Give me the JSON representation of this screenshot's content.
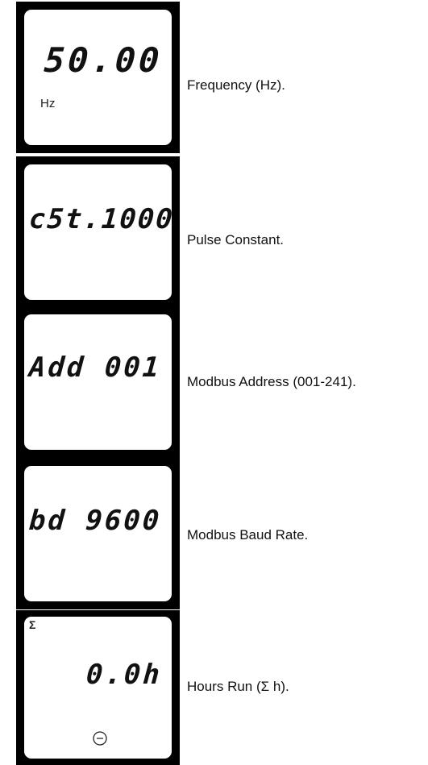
{
  "rows": [
    {
      "display": "50.00",
      "unit": "Hz",
      "caption": "Frequency (Hz)."
    },
    {
      "display": "c5t.1000",
      "caption": "Pulse Constant."
    },
    {
      "display": "Add 001",
      "caption": "Modbus Address (001-241)."
    },
    {
      "display": "bd 9600",
      "caption": "Modbus Baud Rate."
    },
    {
      "display": "0.0h",
      "indicator": "Σ",
      "caption": "Hours Run (Σ h).",
      "icon": "clock-icon"
    }
  ]
}
